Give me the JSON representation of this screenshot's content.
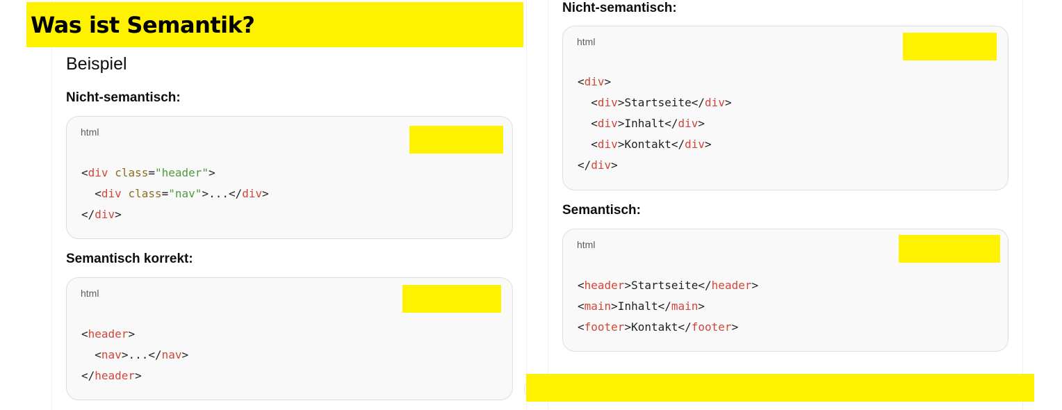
{
  "title": "Was ist Semantik?",
  "left": {
    "heading": "Beispiel",
    "section1_label": "Nicht-semantisch:",
    "section2_label": "Semantisch korrekt:",
    "code1": {
      "lang": "html",
      "lines": [
        [
          [
            "punc",
            "<"
          ],
          [
            "tag",
            "div"
          ],
          [
            "punc",
            " "
          ],
          [
            "attr",
            "class"
          ],
          [
            "punc",
            "="
          ],
          [
            "str",
            "\"header\""
          ],
          [
            "punc",
            ">"
          ]
        ],
        [
          [
            "punc",
            "  <"
          ],
          [
            "tag",
            "div"
          ],
          [
            "punc",
            " "
          ],
          [
            "attr",
            "class"
          ],
          [
            "punc",
            "="
          ],
          [
            "str",
            "\"nav\""
          ],
          [
            "punc",
            ">...</"
          ],
          [
            "tag",
            "div"
          ],
          [
            "punc",
            ">"
          ]
        ],
        [
          [
            "punc",
            "</"
          ],
          [
            "tag",
            "div"
          ],
          [
            "punc",
            ">"
          ]
        ]
      ]
    },
    "code2": {
      "lang": "html",
      "lines": [
        [
          [
            "punc",
            "<"
          ],
          [
            "tag",
            "header"
          ],
          [
            "punc",
            ">"
          ]
        ],
        [
          [
            "punc",
            "  <"
          ],
          [
            "tag",
            "nav"
          ],
          [
            "punc",
            ">...</"
          ],
          [
            "tag",
            "nav"
          ],
          [
            "punc",
            ">"
          ]
        ],
        [
          [
            "punc",
            "</"
          ],
          [
            "tag",
            "header"
          ],
          [
            "punc",
            ">"
          ]
        ]
      ]
    }
  },
  "right": {
    "section1_label": "Nicht-semantisch:",
    "section2_label": "Semantisch:",
    "code1": {
      "lang": "html",
      "lines": [
        [
          [
            "punc",
            "<"
          ],
          [
            "tag",
            "div"
          ],
          [
            "punc",
            ">"
          ]
        ],
        [
          [
            "punc",
            "  <"
          ],
          [
            "tag",
            "div"
          ],
          [
            "punc",
            ">Startseite</"
          ],
          [
            "tag",
            "div"
          ],
          [
            "punc",
            ">"
          ]
        ],
        [
          [
            "punc",
            "  <"
          ],
          [
            "tag",
            "div"
          ],
          [
            "punc",
            ">Inhalt</"
          ],
          [
            "tag",
            "div"
          ],
          [
            "punc",
            ">"
          ]
        ],
        [
          [
            "punc",
            "  <"
          ],
          [
            "tag",
            "div"
          ],
          [
            "punc",
            ">Kontakt</"
          ],
          [
            "tag",
            "div"
          ],
          [
            "punc",
            ">"
          ]
        ],
        [
          [
            "punc",
            "</"
          ],
          [
            "tag",
            "div"
          ],
          [
            "punc",
            ">"
          ]
        ]
      ]
    },
    "code2": {
      "lang": "html",
      "lines": [
        [
          [
            "punc",
            "<"
          ],
          [
            "tag",
            "header"
          ],
          [
            "punc",
            ">Startseite</"
          ],
          [
            "tag",
            "header"
          ],
          [
            "punc",
            ">"
          ]
        ],
        [
          [
            "punc",
            "<"
          ],
          [
            "tag",
            "main"
          ],
          [
            "punc",
            ">Inhalt</"
          ],
          [
            "tag",
            "main"
          ],
          [
            "punc",
            ">"
          ]
        ],
        [
          [
            "punc",
            "<"
          ],
          [
            "tag",
            "footer"
          ],
          [
            "punc",
            ">Kontakt</"
          ],
          [
            "tag",
            "footer"
          ],
          [
            "punc",
            ">"
          ]
        ]
      ]
    }
  },
  "colors": {
    "highlight": "#fff200",
    "tag": "#d0463b",
    "attribute": "#8a6d1f",
    "string": "#4f9a3f",
    "code_background": "#f9f9f9"
  }
}
